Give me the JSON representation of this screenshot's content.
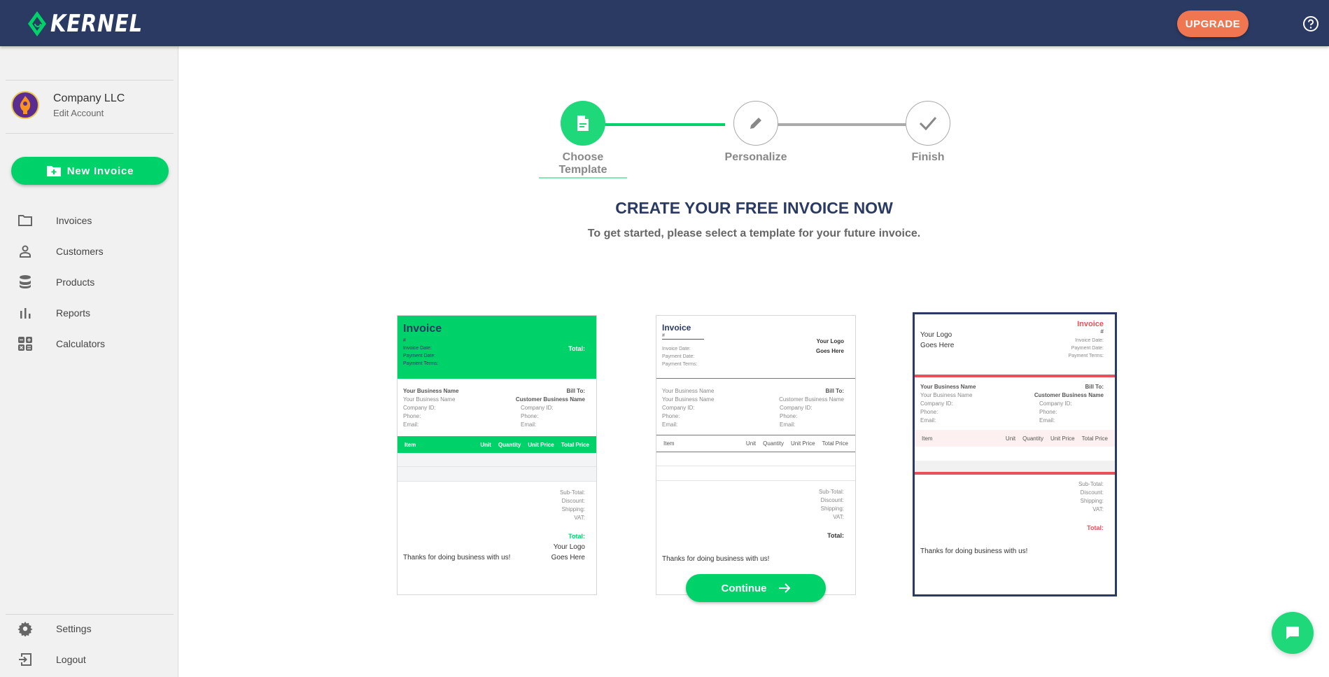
{
  "header": {
    "brand": "KERNEL",
    "upgrade_label": "UPGRADE",
    "help_icon": "question-circle-icon"
  },
  "sidebar": {
    "account": {
      "name": "Company LLC",
      "edit_label": "Edit Account"
    },
    "new_invoice_label": "New Invoice",
    "items": [
      {
        "label": "Invoices",
        "icon": "folder-icon"
      },
      {
        "label": "Customers",
        "icon": "person-icon"
      },
      {
        "label": "Products",
        "icon": "database-icon"
      },
      {
        "label": "Reports",
        "icon": "bar-chart-icon"
      },
      {
        "label": "Calculators",
        "icon": "calculator-icon"
      }
    ],
    "bottom_items": [
      {
        "label": "Settings",
        "icon": "gear-icon"
      },
      {
        "label": "Logout",
        "icon": "logout-icon"
      }
    ]
  },
  "stepper": {
    "steps": [
      {
        "label": "Choose Template",
        "state": "active",
        "icon": "document-icon"
      },
      {
        "label": "Personalize",
        "state": "inactive",
        "icon": "pencil-icon"
      },
      {
        "label": "Finish",
        "state": "inactive",
        "icon": "check-icon"
      }
    ]
  },
  "main": {
    "title": "CREATE YOUR FREE INVOICE NOW",
    "subtitle": "To get started, please select a template for your future invoice.",
    "continue_label": "Continue"
  },
  "templates": {
    "accent_colors": {
      "green": "#00d26a",
      "navy": "#2a3a62",
      "red": "#e8505b"
    },
    "selected_index": 2,
    "common": {
      "invoice": "Invoice",
      "hash": "#",
      "invoice_date": "Invoice Date:",
      "payment_date": "Payment Date:",
      "payment_terms": "Payment Terms:",
      "total": "Total:",
      "your_business_name": "Your Business Name",
      "bill_to": "Bill To:",
      "customer_business_name": "Customer Business Name",
      "company_id": "Company ID:",
      "phone": "Phone:",
      "email": "Email:",
      "columns": [
        "Item",
        "Unit",
        "Quantity",
        "Unit Price",
        "Total Price"
      ],
      "sub_total": "Sub-Total:",
      "discount": "Discount:",
      "shipping": "Shipping:",
      "vat": "VAT:",
      "logo_line1": "Your Logo",
      "logo_line2": "Goes Here",
      "thanks": "Thanks for doing business with us!"
    }
  },
  "chat": {
    "icon": "chat-bubble-icon"
  }
}
